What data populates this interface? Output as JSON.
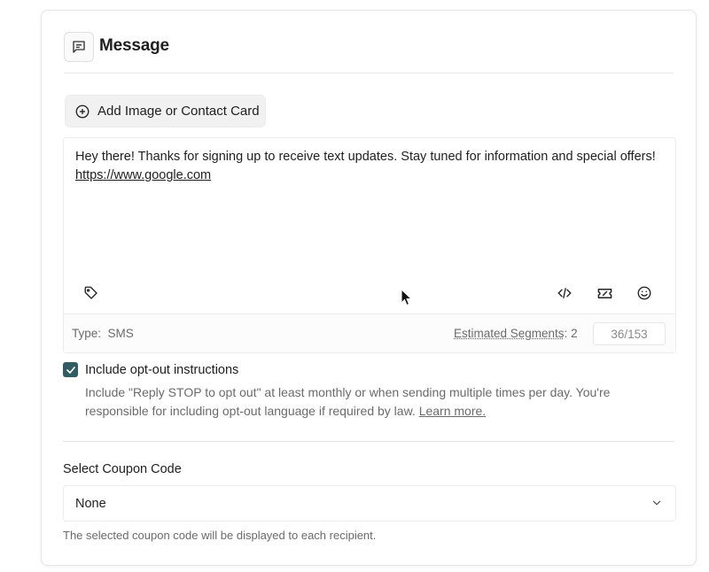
{
  "header": {
    "title": "Message",
    "icon": "message-square-icon"
  },
  "add_media": {
    "label": "Add Image or Contact Card",
    "icon": "plus-circle-icon"
  },
  "editor": {
    "text": "Hey there! Thanks for signing up to receive text updates. Stay tuned for information and special offers!",
    "link": "https://www.google.com",
    "tools": [
      "tag-icon",
      "code-icon",
      "coupon-icon",
      "emoji-icon"
    ]
  },
  "footer": {
    "type_prefix": "Type:",
    "type_value": "SMS",
    "segments_label": "Estimated Segments",
    "segments_value": ": 2",
    "counter": "36/153"
  },
  "optout": {
    "checked": true,
    "title": "Include opt-out instructions",
    "description": "Include \"Reply STOP to opt out\" at least monthly or when sending multiple times per day. You're responsible for including opt-out language if required by law.",
    "learn_more": "Learn more."
  },
  "coupon": {
    "label": "Select Coupon Code",
    "selected": "None",
    "help": "The selected coupon code will be displayed to each recipient."
  },
  "colors": {
    "checkbox": "#2f5d62",
    "button_bg": "#f1f1f1",
    "border": "#ececec",
    "muted_text": "#6b6b6b"
  }
}
